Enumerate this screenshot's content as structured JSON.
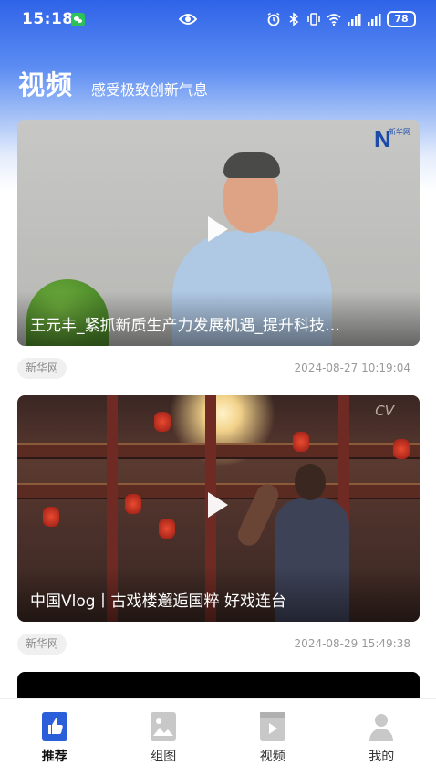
{
  "status_bar": {
    "time": "15:18",
    "battery": "78",
    "icons": [
      "wechat-icon",
      "eye-icon",
      "alarm-icon",
      "bluetooth-icon",
      "vibrate-icon",
      "wifi-icon",
      "signal-icon",
      "signal-icon",
      "battery-icon"
    ]
  },
  "header": {
    "title": "视频",
    "subtitle": "感受极致创新气息"
  },
  "videos": [
    {
      "title": "王元丰_紧抓新质生产力发展机遇_提升科技…",
      "source": "新华网",
      "time": "2024-08-27 10:19:04",
      "logo_text": "N",
      "logo_sub": "新华网"
    },
    {
      "title": "中国Vlog丨古戏楼邂逅国粹 好戏连台",
      "source": "新华网",
      "time": "2024-08-29 15:49:38",
      "watermark": "CV"
    }
  ],
  "bottom_nav": {
    "items": [
      {
        "label": "推荐",
        "icon": "thumbs-up-icon",
        "active": true
      },
      {
        "label": "组图",
        "icon": "image-icon",
        "active": false
      },
      {
        "label": "视频",
        "icon": "video-play-icon",
        "active": false
      },
      {
        "label": "我的",
        "icon": "user-icon",
        "active": false
      }
    ]
  },
  "colors": {
    "header_blue": "#2f63e8",
    "nav_active": "#2a5fd9",
    "nav_inactive": "#c8c8c8"
  }
}
